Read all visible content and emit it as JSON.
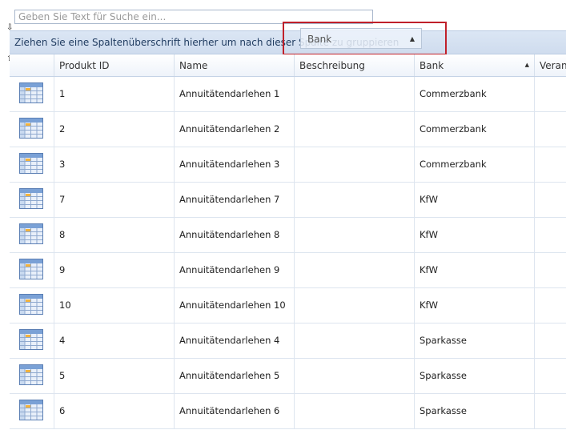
{
  "search": {
    "placeholder": "Geben Sie Text für Suche ein...",
    "value": ""
  },
  "group_panel": {
    "hint": "Ziehen Sie eine Spaltenüberschrift hierher um nach dieser Spalte zu gruppieren"
  },
  "drag_header": {
    "label": "Bank"
  },
  "columns": [
    "",
    "Produkt ID",
    "Name",
    "Beschreibung",
    "Bank",
    "Verant"
  ],
  "sort": {
    "column": "Bank",
    "direction": "ascending"
  },
  "rows": [
    {
      "id": "1",
      "name": "Annuitätendarlehen 1",
      "beschreibung": "",
      "bank": "Commerzbank",
      "verant": ""
    },
    {
      "id": "2",
      "name": "Annuitätendarlehen 2",
      "beschreibung": "",
      "bank": "Commerzbank",
      "verant": ""
    },
    {
      "id": "3",
      "name": "Annuitätendarlehen 3",
      "beschreibung": "",
      "bank": "Commerzbank",
      "verant": ""
    },
    {
      "id": "7",
      "name": "Annuitätendarlehen 7",
      "beschreibung": "",
      "bank": "KfW",
      "verant": ""
    },
    {
      "id": "8",
      "name": "Annuitätendarlehen 8",
      "beschreibung": "",
      "bank": "KfW",
      "verant": ""
    },
    {
      "id": "9",
      "name": "Annuitätendarlehen 9",
      "beschreibung": "",
      "bank": "KfW",
      "verant": ""
    },
    {
      "id": "10",
      "name": "Annuitätendarlehen 10",
      "beschreibung": "",
      "bank": "KfW",
      "verant": ""
    },
    {
      "id": "4",
      "name": "Annuitätendarlehen 4",
      "beschreibung": "",
      "bank": "Sparkasse",
      "verant": ""
    },
    {
      "id": "5",
      "name": "Annuitätendarlehen 5",
      "beschreibung": "",
      "bank": "Sparkasse",
      "verant": ""
    },
    {
      "id": "6",
      "name": "Annuitätendarlehen 6",
      "beschreibung": "",
      "bank": "Sparkasse",
      "verant": ""
    }
  ],
  "colors": {
    "accent": "#c0202a",
    "header_bg": "#dbe6f4",
    "row_border": "#dde5ef"
  },
  "icons": {
    "row_icon": "table-icon",
    "drop_marker": "arrow-marker-icon"
  }
}
